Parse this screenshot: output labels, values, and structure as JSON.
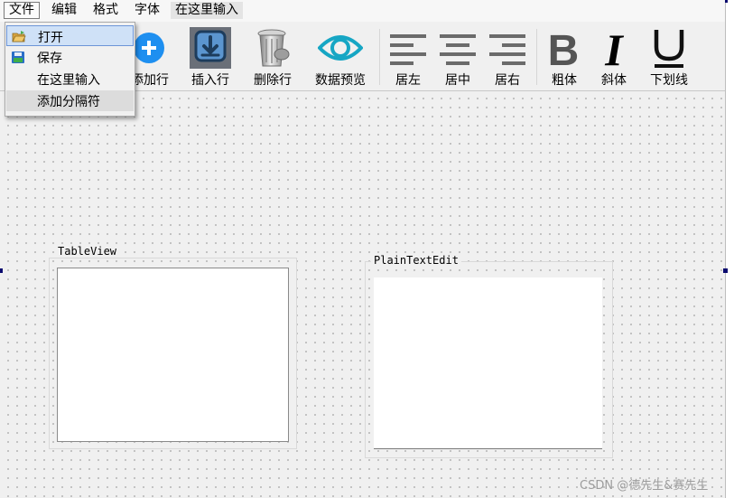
{
  "menubar": {
    "items": [
      {
        "label": "文件"
      },
      {
        "label": "编辑"
      },
      {
        "label": "格式"
      },
      {
        "label": "字体"
      },
      {
        "label": "在这里输入"
      }
    ]
  },
  "file_menu": {
    "items": [
      {
        "label": "打开",
        "icon": "open-folder-icon"
      },
      {
        "label": "保存",
        "icon": "save-disk-icon"
      },
      {
        "label": "在这里输入"
      },
      {
        "label": "添加分隔符"
      }
    ]
  },
  "toolbar": {
    "items": [
      {
        "label": "添加行",
        "icon": "add-circle-icon"
      },
      {
        "label": "插入行",
        "icon": "insert-download-icon"
      },
      {
        "label": "删除行",
        "icon": "trash-can-icon"
      },
      {
        "label": "数据预览",
        "icon": "eye-icon"
      },
      {
        "label": "居左",
        "icon": "align-left-icon"
      },
      {
        "label": "居中",
        "icon": "align-center-icon"
      },
      {
        "label": "居右",
        "icon": "align-right-icon"
      },
      {
        "label": "粗体",
        "icon": "bold-icon"
      },
      {
        "label": "斜体",
        "icon": "italic-icon"
      },
      {
        "label": "下划线",
        "icon": "underline-icon"
      }
    ]
  },
  "groups": {
    "table": {
      "title": "TableView"
    },
    "text": {
      "title": "PlainTextEdit"
    }
  },
  "watermark": "CSDN @德先生&赛先生",
  "colors": {
    "accent_blue": "#1e8ff0",
    "menu_highlight": "#cfe1f7",
    "teal_eye": "#16a6c4"
  }
}
